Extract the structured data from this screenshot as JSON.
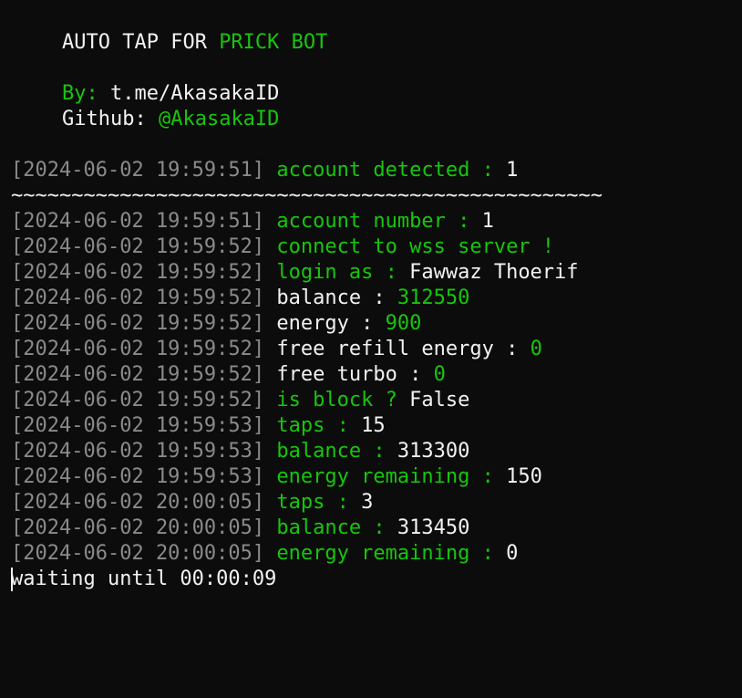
{
  "banner": {
    "title_prefix": "AUTO TAP FOR ",
    "title_name": "PRICK BOT",
    "by_label": "By: ",
    "by_value": "t.me/AkasakaID",
    "github_label": "Github: ",
    "github_value": "@AkasakaID"
  },
  "first_log": {
    "timestamp": "[2024-06-02 19:59:51]",
    "label": "account detected : ",
    "value": "1"
  },
  "separator": "~~~~~~~~~~~~~~~~~~~~~~~~~~~~~~~~~~~~~~~~~~~~~~~~~",
  "logs": [
    {
      "timestamp": "[2024-06-02 19:59:51]",
      "label": "account number : ",
      "label_color": "green",
      "value": "1",
      "value_color": "white"
    },
    {
      "timestamp": "[2024-06-02 19:59:52]",
      "label": "connect to wss server !",
      "label_color": "green",
      "value": "",
      "value_color": "white"
    },
    {
      "timestamp": "[2024-06-02 19:59:52]",
      "label": "login as : ",
      "label_color": "green",
      "value": "Fawwaz Thoerif",
      "value_color": "white"
    },
    {
      "timestamp": "[2024-06-02 19:59:52]",
      "label": "balance : ",
      "label_color": "white",
      "value": "312550",
      "value_color": "green"
    },
    {
      "timestamp": "[2024-06-02 19:59:52]",
      "label": "energy : ",
      "label_color": "white",
      "value": "900",
      "value_color": "green"
    },
    {
      "timestamp": "[2024-06-02 19:59:52]",
      "label": "free refill energy : ",
      "label_color": "white",
      "value": "0",
      "value_color": "green"
    },
    {
      "timestamp": "[2024-06-02 19:59:52]",
      "label": "free turbo : ",
      "label_color": "white",
      "value": "0",
      "value_color": "green"
    },
    {
      "timestamp": "[2024-06-02 19:59:52]",
      "label": "is block ? ",
      "label_color": "green",
      "value": "False",
      "value_color": "white"
    },
    {
      "timestamp": "[2024-06-02 19:59:53]",
      "label": "taps : ",
      "label_color": "green",
      "value": "15",
      "value_color": "white"
    },
    {
      "timestamp": "[2024-06-02 19:59:53]",
      "label": "balance : ",
      "label_color": "green",
      "value": "313300",
      "value_color": "white"
    },
    {
      "timestamp": "[2024-06-02 19:59:53]",
      "label": "energy remaining : ",
      "label_color": "green",
      "value": "150",
      "value_color": "white"
    },
    {
      "timestamp": "[2024-06-02 20:00:05]",
      "label": "taps : ",
      "label_color": "green",
      "value": "3",
      "value_color": "white"
    },
    {
      "timestamp": "[2024-06-02 20:00:05]",
      "label": "balance : ",
      "label_color": "green",
      "value": "313450",
      "value_color": "white"
    },
    {
      "timestamp": "[2024-06-02 20:00:05]",
      "label": "energy remaining : ",
      "label_color": "green",
      "value": "0",
      "value_color": "white"
    }
  ],
  "waiting_text": "waiting until 00:00:09",
  "colors": {
    "background": "#0c0c0c",
    "text": "#f2f2f2",
    "green": "#16c60c",
    "timestamp": "#8a8a8a"
  }
}
